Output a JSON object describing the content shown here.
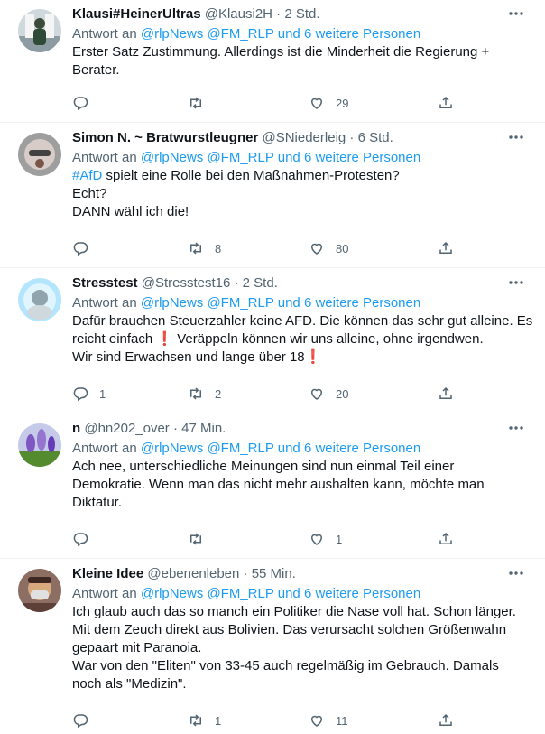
{
  "tweets": [
    {
      "name": "Klausi#HeinerUltras",
      "handle": "@Klausi2H",
      "sep": " · ",
      "time": "2 Std.",
      "reply_prefix": "Antwort an ",
      "reply_to": "@rlpNews @FM_RLP und 6 weitere Personen",
      "lines": [
        "Erster Satz Zustimmung. Allerdings ist die Minderheit die Regierung +",
        "Berater."
      ],
      "replies": "",
      "retweets": "",
      "likes": "29"
    },
    {
      "name": "Simon N. ~ Bratwurstleugner",
      "handle": "@SNiederleig",
      "sep": " · ",
      "time": "6 Std.",
      "reply_prefix": "Antwort an ",
      "reply_to": "@rlpNews @FM_RLP und 6 weitere Personen",
      "hashtag": "#AfD",
      "line1_rest": " spielt eine Rolle bei den Maßnahmen-Protesten?",
      "lines": [
        "Echt?",
        "DANN wähl ich die!"
      ],
      "replies": "",
      "retweets": "8",
      "likes": "80"
    },
    {
      "name": "Stresstest",
      "handle": "@Stresstest16",
      "sep": " · ",
      "time": "2 Std.",
      "reply_prefix": "Antwort an ",
      "reply_to": "@rlpNews @FM_RLP und 6 weitere Personen",
      "line1": "Dafür brauchen Steuerzahler keine AFD. Die können das sehr gut alleine. Es",
      "line2a": "reicht einfach ",
      "line2b": " Veräppeln können wir uns alleine, ohne irgendwen.",
      "line3a": "Wir sind Erwachsen und lange über 18",
      "exclamation": "❗",
      "replies": "1",
      "retweets": "2",
      "likes": "20"
    },
    {
      "name": "n",
      "handle": "@hn202_over",
      "sep": " · ",
      "time": "47 Min.",
      "reply_prefix": "Antwort an ",
      "reply_to": "@rlpNews @FM_RLP und 6 weitere Personen",
      "lines": [
        "Ach nee, unterschiedliche Meinungen sind nun einmal Teil einer",
        "Demokratie. Wenn man das nicht mehr aushalten kann, möchte man",
        "Diktatur."
      ],
      "replies": "",
      "retweets": "",
      "likes": "1"
    },
    {
      "name": "Kleine Idee",
      "handle": "@ebenenleben",
      "sep": " · ",
      "time": "55 Min.",
      "reply_prefix": "Antwort an ",
      "reply_to": "@rlpNews @FM_RLP und 6 weitere Personen",
      "lines": [
        "Ich glaub auch das so manch ein Politiker die Nase voll hat. Schon länger.",
        "Mit dem Zeuch direkt aus Bolivien. Das verursacht solchen Größenwahn",
        "gepaart mit Paranoia.",
        "War von den \"Eliten\" von 33-45 auch regelmäßig im Gebrauch. Damals",
        "noch als \"Medizin\"."
      ],
      "replies": "",
      "retweets": "1",
      "likes": "11"
    }
  ],
  "colors": {
    "accent": "#1d9bf0",
    "secondary": "#536471",
    "divider": "#eff3f4",
    "emoji_red": "#dc1f26"
  },
  "icons": [
    "more-icon",
    "reply-icon",
    "retweet-icon",
    "like-icon",
    "share-icon"
  ]
}
